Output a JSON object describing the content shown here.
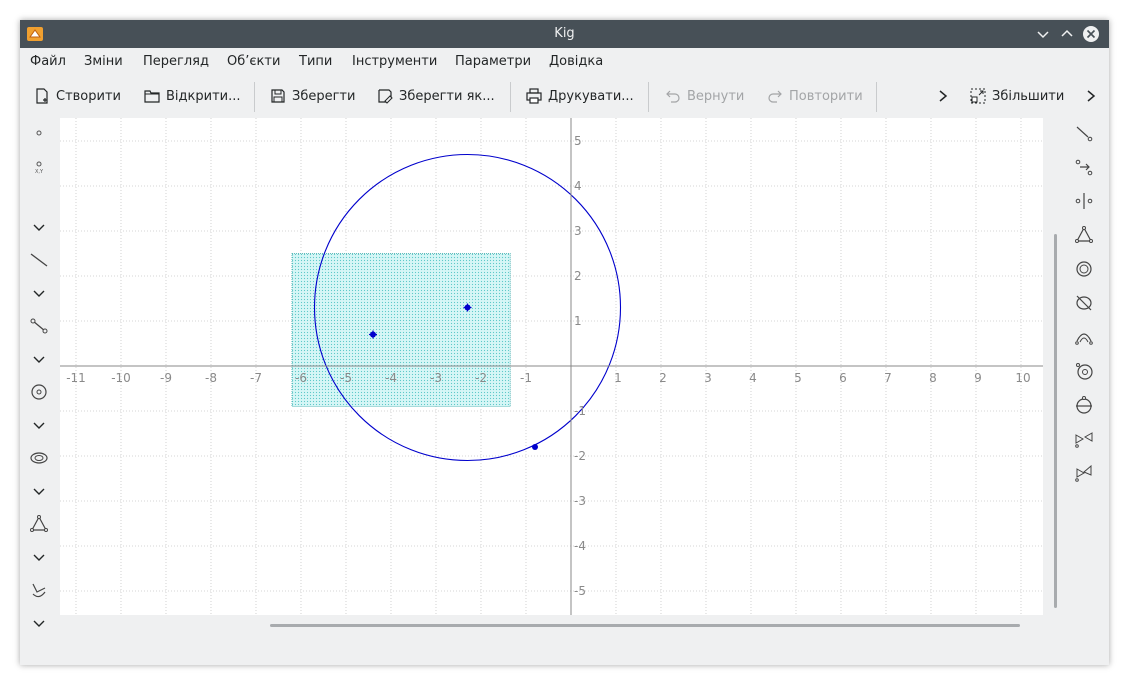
{
  "window": {
    "title": "Kig"
  },
  "menu": [
    "Файл",
    "Зміни",
    "Перегляд",
    "Об’єкти",
    "Типи",
    "Інструменти",
    "Параметри",
    "Довідка"
  ],
  "toolbar": {
    "new": "Створити",
    "open": "Відкрити...",
    "save": "Зберегти",
    "save_as": "Зберегти як...",
    "print": "Друкувати...",
    "undo": "Вернути",
    "redo": "Повторити",
    "zoom": "Збільшити"
  },
  "colors": {
    "titlebar": "#475057",
    "accent_blue": "#0000cc",
    "polygon_fill": "#00c8c8",
    "axis": "#888888",
    "grid": "#c8c8c8"
  },
  "canvas": {
    "x_ticks": [
      "-11",
      "-10",
      "-9",
      "-8",
      "-7",
      "-6",
      "-5",
      "-4",
      "-3",
      "-2",
      "-1",
      "1",
      "2",
      "3",
      "4",
      "5",
      "6",
      "7",
      "8",
      "9",
      "10"
    ],
    "y_ticks": [
      "5",
      "4",
      "3",
      "2",
      "1",
      "-1",
      "-2",
      "-3",
      "-4",
      "-5"
    ],
    "xlim": [
      -11,
      11
    ],
    "ylim": [
      -5.5,
      5.5
    ],
    "circle": {
      "center": [
        -2.3,
        1.3
      ],
      "radius": 3.4
    },
    "rectangle": {
      "x_min": -6.2,
      "x_max": -1.35,
      "y_min": -0.9,
      "y_max": 2.5
    },
    "points": [
      {
        "x": -4.4,
        "y": 0.7
      },
      {
        "x": -2.3,
        "y": 1.3
      },
      {
        "x": -0.8,
        "y": -1.8
      }
    ]
  },
  "left_tools": [
    "point-icon",
    "point-by-coords-icon",
    "expand-icon",
    "line-icon",
    "expand-icon",
    "segment-icon",
    "expand-icon",
    "circle-icon",
    "expand-icon",
    "conic-icon",
    "expand-icon",
    "polygon-icon",
    "expand-icon",
    "transform-icon",
    "expand-icon"
  ],
  "right_tools": [
    "ray-icon",
    "vector-icon",
    "midpoint-icon",
    "triangle-icon",
    "arc-icon",
    "ellipse-icon",
    "arc-three-points-icon",
    "circle-by-point-icon",
    "circle-center-icon",
    "mirror-icon",
    "rotation-icon"
  ]
}
